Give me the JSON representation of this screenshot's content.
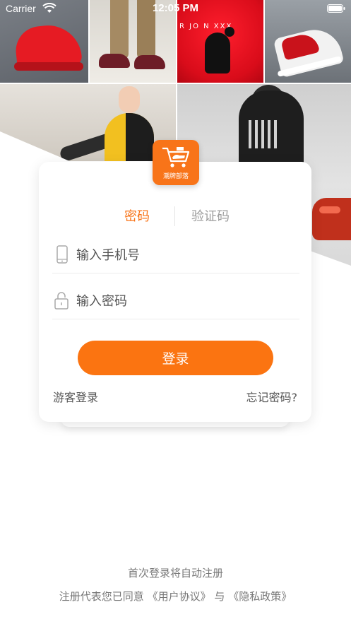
{
  "status_bar": {
    "carrier": "Carrier",
    "time": "12:05 PM",
    "wifi_icon": "wifi-icon",
    "battery_icon": "battery-icon"
  },
  "banner": {
    "jordan_print": "R JO   N XXX"
  },
  "logo": {
    "icon": "shopping-cart-icon",
    "text": "潮牌部落",
    "color": "#f87419"
  },
  "tabs": [
    {
      "label": "密码",
      "active": true
    },
    {
      "label": "验证码",
      "active": false
    }
  ],
  "form": {
    "phone_placeholder": "输入手机号",
    "phone_icon": "phone-icon",
    "password_placeholder": "输入密码",
    "password_icon": "lock-icon",
    "login_label": "登录",
    "guest_label": "游客登录",
    "forgot_label": "忘记密码?"
  },
  "footer": {
    "auto_register": "首次登录将自动注册",
    "terms_prefix": "注册代表您已同意",
    "user_agreement": "《用户协议》",
    "joiner": "与",
    "privacy_policy": "《隐私政策》"
  },
  "colors": {
    "accent": "#fb7411",
    "tab_active": "#f87419",
    "tab_inactive": "#9c9c9c",
    "text_muted": "#777777"
  }
}
